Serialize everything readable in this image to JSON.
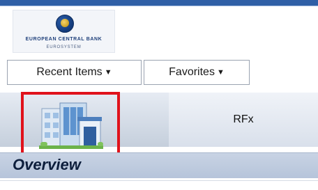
{
  "brand": {
    "name": "EUROPEAN CENTRAL BANK",
    "subname": "EUROSYSTEM"
  },
  "nav": {
    "recent_label": "Recent Items",
    "favorites_label": "Favorites",
    "caret": "▼"
  },
  "tabs": [
    {
      "label": "",
      "icon": "building-icon",
      "highlighted": true
    },
    {
      "label": "RFx"
    }
  ],
  "section": {
    "title": "Overview"
  },
  "colors": {
    "top_bar": "#2f5fa6",
    "highlight_border": "#e0121b",
    "overview_bar": "#c8d3e4"
  }
}
